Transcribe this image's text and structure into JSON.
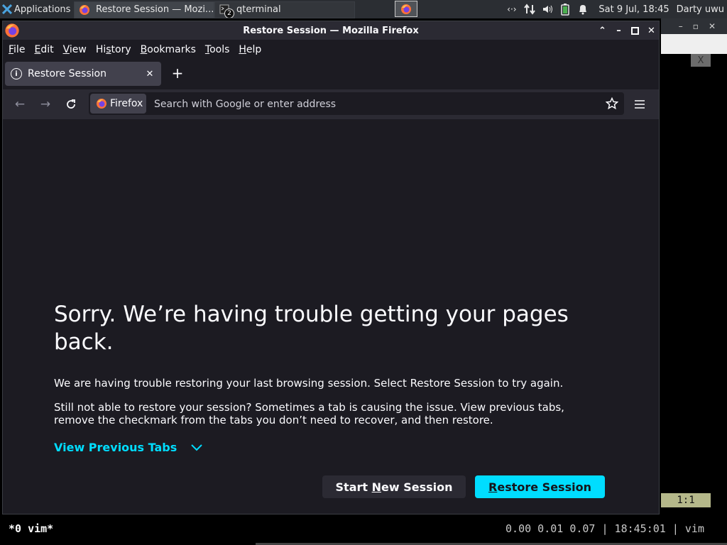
{
  "panel": {
    "applications_label": "Applications",
    "tasks": [
      {
        "label": "Restore Session — Mozi..."
      },
      {
        "label": "qterminal",
        "badge": "2"
      }
    ],
    "clock": "Sat  9 Jul, 18:45",
    "user": "Darty uwu",
    "tray_icons": [
      "network-icon",
      "transfer-icon",
      "volume-icon",
      "battery-icon",
      "bell-icon"
    ]
  },
  "window": {
    "title": "Restore Session — Mozilla Firefox"
  },
  "menubar": {
    "items": [
      {
        "first": "F",
        "rest": "ile"
      },
      {
        "first": "E",
        "rest": "dit"
      },
      {
        "first": "V",
        "rest": "iew"
      },
      {
        "pre": "Hi",
        "first": "s",
        "rest": "tory"
      },
      {
        "first": "B",
        "rest": "ookmarks"
      },
      {
        "first": "T",
        "rest": "ools"
      },
      {
        "first": "H",
        "rest": "elp"
      }
    ]
  },
  "tab": {
    "label": "Restore Session"
  },
  "navbar": {
    "identity_label": "Firefox",
    "url_placeholder": "Search with Google or enter address"
  },
  "content": {
    "heading": "Sorry. We’re having trouble getting your pages back.",
    "paragraph1": "We are having trouble restoring your last browsing session. Select Restore Session to try again.",
    "paragraph2": "Still not able to restore your session? Sometimes a tab is causing the issue. View previous tabs, remove the checkmark from the tabs you don’t need to recover, and then restore.",
    "view_previous_tabs": "View Previous Tabs",
    "start_new_session": {
      "pre": "Start ",
      "u": "N",
      "post": "ew Session"
    },
    "restore_session": {
      "pre": "",
      "u": "R",
      "post": "estore Session"
    }
  },
  "terminal": {
    "x_button": "X",
    "cursor_pos": "1:1"
  },
  "tmux": {
    "window_label": "*0 vim*",
    "status": "0.00 0.01 0.07 | 18:45:01 | vim"
  },
  "colors": {
    "accent": "#00ddff",
    "page_bg": "#1c1b22",
    "toolbar_bg": "#2b2a33"
  }
}
